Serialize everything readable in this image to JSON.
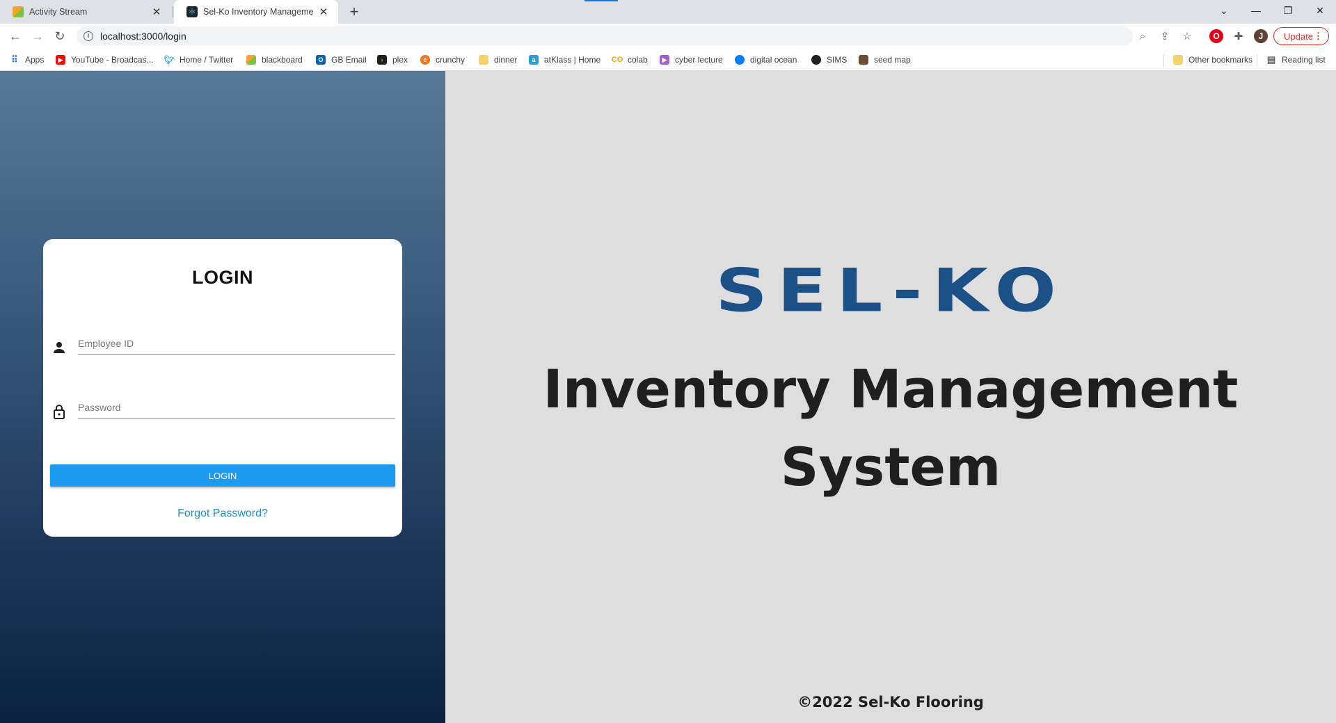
{
  "browser": {
    "tabs": [
      {
        "title": "Activity Stream",
        "icon": "blackboard-icon",
        "active": false
      },
      {
        "title": "Sel-Ko Inventory Management Sy",
        "icon": "react-icon",
        "active": true
      }
    ],
    "new_tab_symbol": "+",
    "url": "localhost:3000/login",
    "update_label": "Update",
    "profile_initial": "J",
    "bookmarks": [
      {
        "label": "Apps",
        "icon": "apps-grid-icon"
      },
      {
        "label": "YouTube - Broadcas...",
        "icon": "youtube-icon"
      },
      {
        "label": "Home / Twitter",
        "icon": "twitter-icon"
      },
      {
        "label": "blackboard",
        "icon": "blackboard-icon"
      },
      {
        "label": "GB Email",
        "icon": "outlook-icon"
      },
      {
        "label": "plex",
        "icon": "plex-icon"
      },
      {
        "label": "crunchy",
        "icon": "crunchyroll-icon"
      },
      {
        "label": "dinner",
        "icon": "folder-icon"
      },
      {
        "label": "atKlass | Home",
        "icon": "atklass-icon"
      },
      {
        "label": "colab",
        "icon": "colab-icon"
      },
      {
        "label": "cyber lecture",
        "icon": "play-icon"
      },
      {
        "label": "digital ocean",
        "icon": "digitalocean-icon"
      },
      {
        "label": "SIMS",
        "icon": "github-icon"
      },
      {
        "label": "seed map",
        "icon": "seedmap-icon"
      }
    ],
    "other_bookmarks": "Other bookmarks",
    "reading_list": "Reading list"
  },
  "login": {
    "title": "LOGIN",
    "employee_id_placeholder": "Employee ID",
    "employee_id_value": "",
    "password_placeholder": "Password",
    "password_value": "",
    "button_label": "LOGIN",
    "forgot_label": "Forgot Password?"
  },
  "hero": {
    "brand": "SEL-KO",
    "title_line1": "Inventory Management",
    "title_line2": "System",
    "footer": "©2022 Sel-Ko Flooring"
  },
  "colors": {
    "brand": "#1b5187",
    "button": "#1d9bf0",
    "link": "#1a8fd6",
    "panel_top": "#567a97",
    "panel_bottom": "#0c2140"
  }
}
